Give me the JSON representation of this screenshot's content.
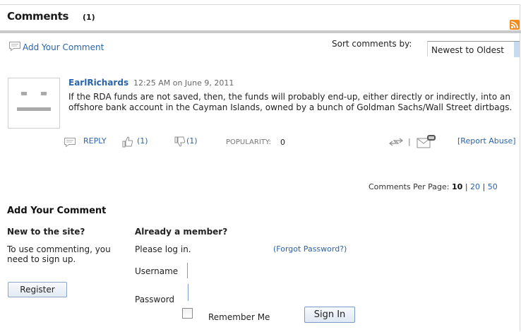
{
  "header": {
    "title": "Comments",
    "count": "(1)",
    "rss_icon": "rss-icon"
  },
  "toolbar": {
    "add_comment_label": "Add Your Comment",
    "sort_label": "Sort comments by:",
    "sort_value": "Newest to Oldest"
  },
  "comments": [
    {
      "author": "EarlRichards",
      "timestamp": "12:25 AM on June 9, 2011",
      "body": "If the RDA funds are not saved, then, the funds will probably end-up, either directly or indirectly, into an offshore bank account in the Cayman Islands, owned by a bunch of Goldman Sachs/Wall Street dirtbags.",
      "reply_label": "REPLY",
      "up_count": "(1)",
      "down_count": "(1)",
      "popularity_label": "POPULARITY:",
      "popularity_value": "0",
      "separator": "|",
      "report_label": "[Report Abuse]"
    }
  ],
  "pagination": {
    "label": "Comments Per Page:",
    "options": [
      "10",
      "20",
      "50"
    ],
    "selected": "10",
    "divider": "|"
  },
  "add_comment": {
    "title": "Add Your Comment",
    "new_heading": "New to the site?",
    "new_text": "To use commenting, you need to sign up.",
    "register_label": "Register",
    "member_heading": "Already a member?",
    "please_log": "Please log in.",
    "forgot_label": "(Forgot Password?)",
    "username_label": "Username",
    "password_label": "Password",
    "remember_label": "Remember Me",
    "signin_label": "Sign In"
  },
  "colors": {
    "link": "#2a64a8",
    "rss": "#f28b1c",
    "rule": "#c9c9c9"
  }
}
